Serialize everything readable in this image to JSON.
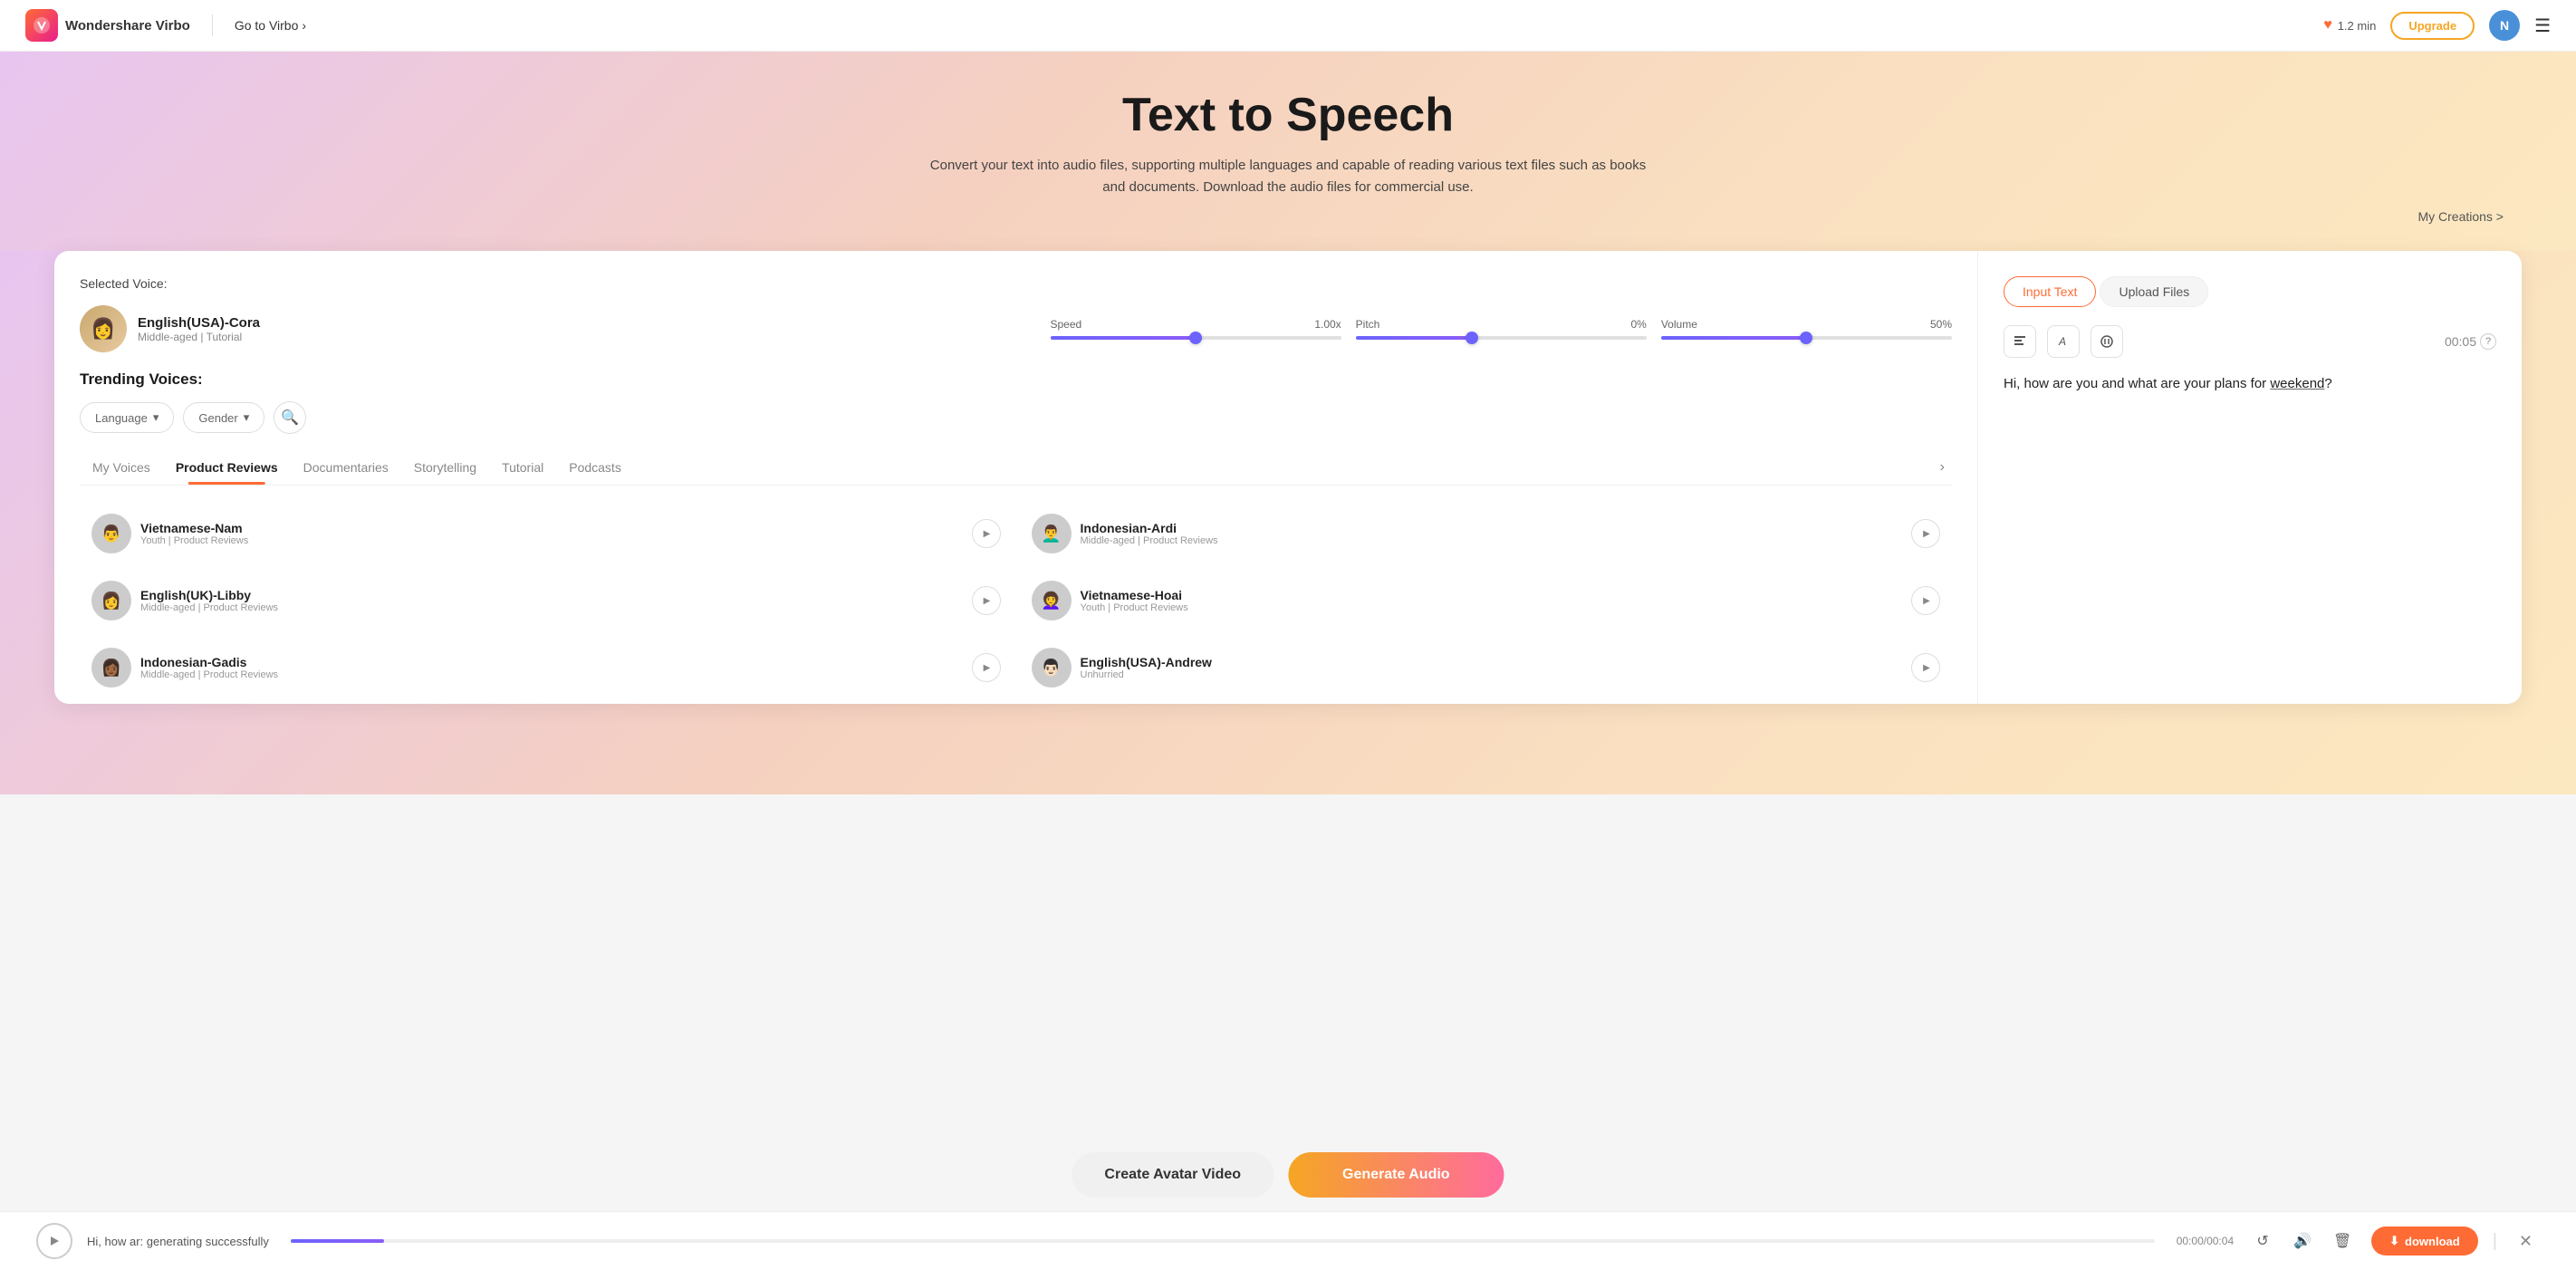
{
  "app": {
    "logo_text": "Wondershare Virbo",
    "goto_label": "Go to Virbo",
    "credits": "1.2 min",
    "upgrade_label": "Upgrade",
    "avatar_initial": "N"
  },
  "hero": {
    "title": "Text to Speech",
    "subtitle": "Convert your text into audio files, supporting multiple languages and capable of reading various text files such as books and documents. Download the audio files for commercial use.",
    "my_creations": "My Creations >"
  },
  "voice_panel": {
    "selected_label": "Selected Voice:",
    "selected_name": "English(USA)-Cora",
    "selected_meta": "Middle-aged | Tutorial",
    "speed_label": "Speed",
    "speed_value": "1.00x",
    "pitch_label": "Pitch",
    "pitch_value": "0%",
    "volume_label": "Volume",
    "volume_value": "50%",
    "trending_label": "Trending Voices:",
    "language_placeholder": "Language",
    "gender_placeholder": "Gender",
    "tabs": [
      {
        "id": "my-voices",
        "label": "My Voices",
        "active": false
      },
      {
        "id": "product-reviews",
        "label": "Product Reviews",
        "active": true
      },
      {
        "id": "documentaries",
        "label": "Documentaries",
        "active": false
      },
      {
        "id": "storytelling",
        "label": "Storytelling",
        "active": false
      },
      {
        "id": "tutorial",
        "label": "Tutorial",
        "active": false
      },
      {
        "id": "podcasts",
        "label": "Podcasts",
        "active": false
      }
    ],
    "voices": [
      {
        "id": "v1",
        "name": "Vietnamese-Nam",
        "meta": "Youth | Product Reviews",
        "col": 0
      },
      {
        "id": "v2",
        "name": "Indonesian-Ardi",
        "meta": "Middle-aged | Product Reviews",
        "col": 1
      },
      {
        "id": "v3",
        "name": "English(UK)-Libby",
        "meta": "Middle-aged | Product Reviews",
        "col": 0
      },
      {
        "id": "v4",
        "name": "Vietnamese-Hoai",
        "meta": "Youth | Product Reviews",
        "col": 1
      },
      {
        "id": "v5",
        "name": "Indonesian-Gadis",
        "meta": "Middle-aged | Product Reviews",
        "col": 0
      },
      {
        "id": "v6",
        "name": "English(USA)-Andrew",
        "meta": "Unhurried",
        "col": 1
      }
    ]
  },
  "text_panel": {
    "input_tab": "Input Text",
    "upload_tab": "Upload Files",
    "timer": "00:05",
    "help_icon": "?",
    "text_content": "Hi, how are you and what are your plans for weekend?",
    "underline_word": "weekend"
  },
  "audio_bar": {
    "text": "Hi, how ar: generating successfully",
    "time": "00:00/00:04",
    "download_label": "download"
  },
  "actions": {
    "create_avatar": "Create Avatar Video",
    "generate_audio": "Generate Audio"
  }
}
